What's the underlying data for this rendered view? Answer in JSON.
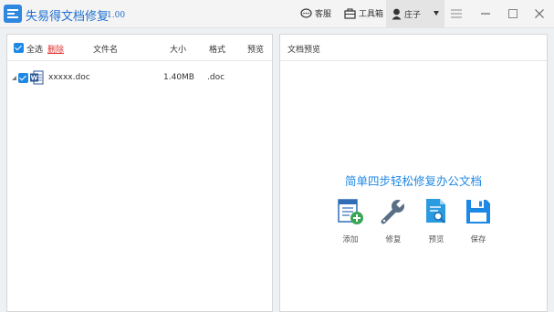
{
  "titlebar": {
    "app_name": "失易得文档修复",
    "version": "1.00",
    "service_label": "客服",
    "toolbox_label": "工具箱",
    "user_name": "庄子"
  },
  "file_list": {
    "select_all_label": "全选",
    "delete_label": "删除",
    "columns": {
      "name": "文件名",
      "size": "大小",
      "format": "格式",
      "preview": "预览"
    },
    "rows": [
      {
        "name": "xxxxx.doc",
        "size": "1.40MB",
        "format": ".doc",
        "checked": true
      }
    ]
  },
  "preview_panel": {
    "title": "文档预览",
    "slogan": "简单四步轻松修复办公文档",
    "steps": [
      {
        "label": "添加",
        "icon": "add-document-icon"
      },
      {
        "label": "修复",
        "icon": "wrench-icon"
      },
      {
        "label": "预览",
        "icon": "preview-document-icon"
      },
      {
        "label": "保存",
        "icon": "save-disk-icon"
      }
    ]
  },
  "colors": {
    "accent": "#1e88e5",
    "title_blue": "#1f6fd0",
    "delete_red": "#e0302b",
    "word_blue": "#2b5797"
  }
}
